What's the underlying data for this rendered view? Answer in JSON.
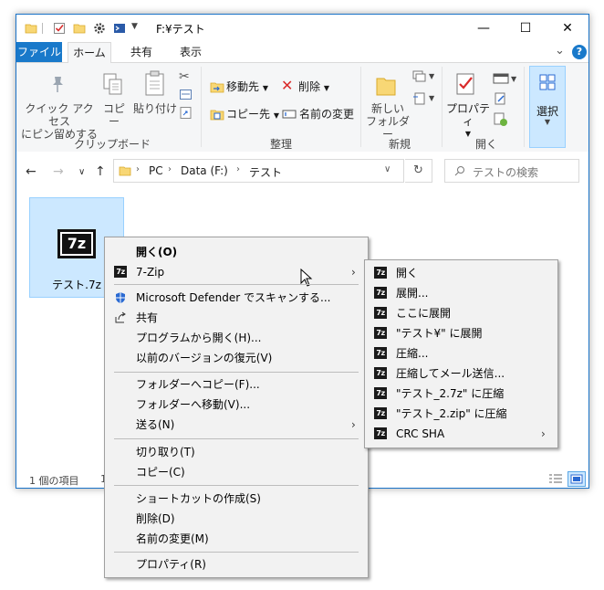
{
  "window": {
    "title": "F:¥テスト",
    "minimize_glyph": "—",
    "maximize_glyph": "☐",
    "close_glyph": "✕",
    "help_glyph": "?",
    "collapse_glyph": "⌄"
  },
  "ribbon_tabs": {
    "file": "ファイル",
    "home": "ホーム",
    "share": "共有",
    "view": "表示"
  },
  "clipboard": {
    "pin_line1": "クイック アクセス",
    "pin_line2": "にピン留めする",
    "copy": "コピー",
    "paste": "貼り付け",
    "group_label": "クリップボード"
  },
  "organize": {
    "move_to": "移動先",
    "copy_to": "コピー先",
    "delete": "削除",
    "rename": "名前の変更",
    "group_label": "整理"
  },
  "new": {
    "new_folder_line1": "新しい",
    "new_folder_line2": "フォルダー",
    "group_label": "新規"
  },
  "open": {
    "properties": "プロパティ",
    "group_label": "開く"
  },
  "select": {
    "select": "選択"
  },
  "address": {
    "crumbs": [
      "PC",
      "Data (F:)",
      "テスト"
    ],
    "search_placeholder": "テストの検索"
  },
  "file": {
    "name": "テスト.7z",
    "icon_text": "7z"
  },
  "status": {
    "item_count": "1 個の項目",
    "selected": "1"
  },
  "context_menu": {
    "items": [
      {
        "label": "開く(O)"
      },
      {
        "label": "7-Zip"
      },
      {
        "label": "Microsoft Defender でスキャンする..."
      },
      {
        "label": "共有"
      },
      {
        "label": "プログラムから開く(H)..."
      },
      {
        "label": "以前のバージョンの復元(V)"
      },
      {
        "label": "フォルダーへコピー(F)..."
      },
      {
        "label": "フォルダーへ移動(V)..."
      },
      {
        "label": "送る(N)"
      },
      {
        "label": "切り取り(T)"
      },
      {
        "label": "コピー(C)"
      },
      {
        "label": "ショートカットの作成(S)"
      },
      {
        "label": "削除(D)"
      },
      {
        "label": "名前の変更(M)"
      },
      {
        "label": "プロパティ(R)"
      }
    ]
  },
  "zip_submenu": {
    "icon_text": "7z",
    "items": [
      {
        "label": "開く"
      },
      {
        "label": "展開..."
      },
      {
        "label": "ここに展開"
      },
      {
        "label": "\"テスト¥\" に展開"
      },
      {
        "label": "圧縮..."
      },
      {
        "label": "圧縮してメール送信..."
      },
      {
        "label": "\"テスト_2.7z\" に圧縮"
      },
      {
        "label": "\"テスト_2.zip\" に圧縮"
      },
      {
        "label": "CRC SHA"
      }
    ]
  },
  "colors": {
    "accent": "#1979ca",
    "selection": "#cce8ff",
    "menu_bg": "#f2f2f2"
  }
}
